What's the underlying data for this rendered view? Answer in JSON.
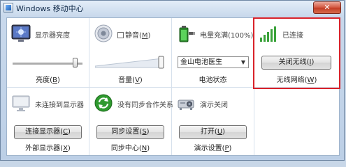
{
  "window": {
    "title": "Windows 移动中心",
    "close_glyph": "✕"
  },
  "tiles": {
    "display": {
      "head": "显示器亮度",
      "foot_prefix": "亮度(",
      "foot_key": "B",
      "foot_suffix": ")",
      "brightness_level": 0.92
    },
    "volume": {
      "head": "静音(",
      "head_key": "M",
      "head_suffix": ")",
      "muted": false,
      "foot_prefix": "音量(",
      "foot_key": "V",
      "foot_suffix": ")",
      "volume_level": 0.98
    },
    "battery": {
      "head": "电量充满(100%)",
      "select_value": "金山电池医生",
      "foot": "电池状态",
      "level_percent": 100
    },
    "wireless": {
      "head": "已连接",
      "button_prefix": "关闭无线(",
      "button_key": "I",
      "button_suffix": ")",
      "foot_prefix": "无线网络(",
      "foot_key": "W",
      "foot_suffix": ")"
    },
    "external": {
      "head": "未连接到显示器",
      "button_prefix": "连接显示器(",
      "button_key": "C",
      "button_suffix": ")",
      "foot_prefix": "外部显示器(",
      "foot_key": "X",
      "foot_suffix": ")"
    },
    "sync": {
      "head": "没有同步合作关系",
      "button_prefix": "同步设置(",
      "button_key": "S",
      "button_suffix": ")",
      "foot_prefix": "同步中心(",
      "foot_key": "N",
      "foot_suffix": ")"
    },
    "presentation": {
      "head": "演示关闭",
      "button_prefix": "打开(",
      "button_key": "U",
      "button_suffix": ")",
      "foot_prefix": "演示设置(",
      "foot_key": "P",
      "foot_suffix": ")"
    }
  },
  "colors": {
    "highlight": "#d9222a",
    "signal_green": "#3aa23a",
    "sync_green": "#2f9a2f"
  }
}
